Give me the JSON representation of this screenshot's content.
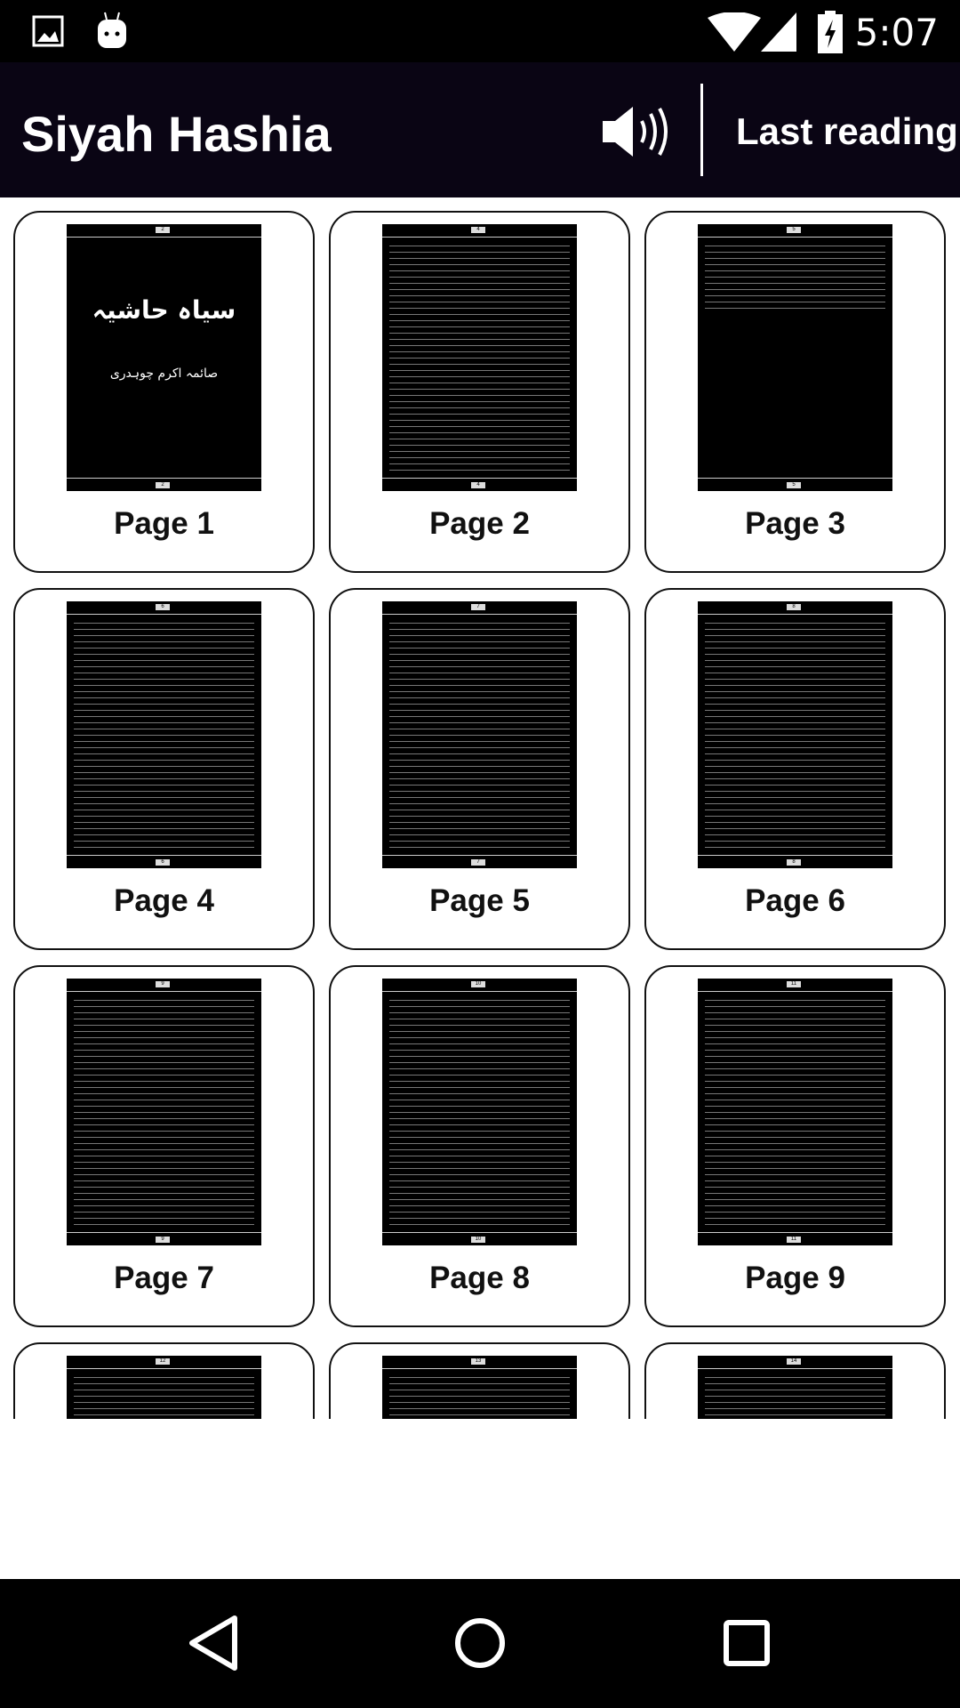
{
  "status_bar": {
    "time": "5:07",
    "icons": [
      "image-icon",
      "android-icon",
      "wifi-icon",
      "signal-icon",
      "battery-charging-icon"
    ]
  },
  "app_bar": {
    "title": "Siyah Hashia",
    "sound_icon": "volume-icon",
    "last_reading": "Last reading"
  },
  "cover": {
    "title": "سیاہ حاشیہ",
    "author": "صائمہ اکرم چوہدری"
  },
  "pages": [
    {
      "label": "Page 1",
      "num": "2"
    },
    {
      "label": "Page 2",
      "num": "4"
    },
    {
      "label": "Page 3",
      "num": "5"
    },
    {
      "label": "Page 4",
      "num": "6"
    },
    {
      "label": "Page 5",
      "num": "7"
    },
    {
      "label": "Page 6",
      "num": "8"
    },
    {
      "label": "Page 7",
      "num": "9"
    },
    {
      "label": "Page 8",
      "num": "10"
    },
    {
      "label": "Page 9",
      "num": "11"
    },
    {
      "label": "",
      "num": "12"
    },
    {
      "label": "",
      "num": "13"
    },
    {
      "label": "",
      "num": "14"
    }
  ],
  "nav": {
    "back": "back-icon",
    "home": "home-icon",
    "recents": "recents-icon"
  }
}
